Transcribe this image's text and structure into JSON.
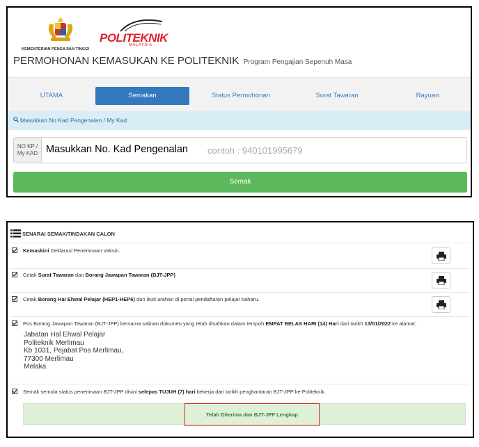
{
  "header": {
    "ministry": "KEMENTERIAN PENGAJIAN TINGGI",
    "logo_text": "POLITEKNIK",
    "logo_sub": "MALAYSIA",
    "title": "PERMOHONAN KEMASUKAN KE POLITEKNIK",
    "subtitle": "Program Pengajian Sepenuh Masa"
  },
  "nav": {
    "items": [
      "UTAMA",
      "Semakan",
      "Status Permohonan",
      "Surat Tawaran",
      "Rayuan"
    ],
    "active": "Semakan"
  },
  "form": {
    "instruction": "Masukkan No Kad Pengenalan / My Kad",
    "addon_line1": "NO KP /",
    "addon_line2": "My KAD",
    "input_label": "Masukkan No. Kad Pengenalan",
    "placeholder": "contoh : 940101995679",
    "submit_label": "Semak"
  },
  "checklist": {
    "heading": "SENARAI SEMAK/TINDAKAN CALON",
    "row1": {
      "b1": "Kemaskini",
      "t1": " Deklarasi Penerimaan Vaksin."
    },
    "row2": {
      "t1": "Cetak ",
      "b1": "Surat Tawaran",
      "t2": " dan ",
      "b2": "Borang Jawapan Tawaran (BJT-JPP)"
    },
    "row3": {
      "t1": "Cetak ",
      "b1": "Borang Hal Ehwal Pelajar (HEP1-HEP6)",
      "t2": " dan ikuti arahan di portal pendaftaran pelajar baharu."
    },
    "row4": {
      "t1": "Pos Borang Jawapan Tawaran (BJT-JPP) bersama salinan dokumen yang telah disahkan dalam tempoh ",
      "b1": "EMPAT BELAS HARI (14) Hari",
      "t2": " dari tarikh ",
      "b2": "13/01/2022",
      "t3": " ke alamat:"
    },
    "address": [
      "Jabatan Hal Ehwal Pelajar",
      "Politeknik Merlimau",
      "Kb 1031, Pejabat Pos Merlimau,",
      "77300 Merlimau",
      "Melaka"
    ],
    "row5": {
      "t1": "Semak semula status penerimaan BJT-JPP disini ",
      "b1": "selepas TUJUH (7) hari",
      "t2": " bekerja dari tarikh penghantaran BJT-JPP ke Politeknik."
    },
    "status": "Telah Diterima dan BJT-JPP Lengkap"
  },
  "icons": {
    "print": "printer-icon",
    "check": "checkbox-checked-icon",
    "list": "list-icon",
    "search": "search-icon"
  },
  "colors": {
    "nav_active": "#3478be",
    "button_green": "#5cb85c",
    "info_bg": "#d9edf7",
    "status_bg": "#dff0d8",
    "logo_red": "#e0212d",
    "status_border": "#c9302c"
  }
}
